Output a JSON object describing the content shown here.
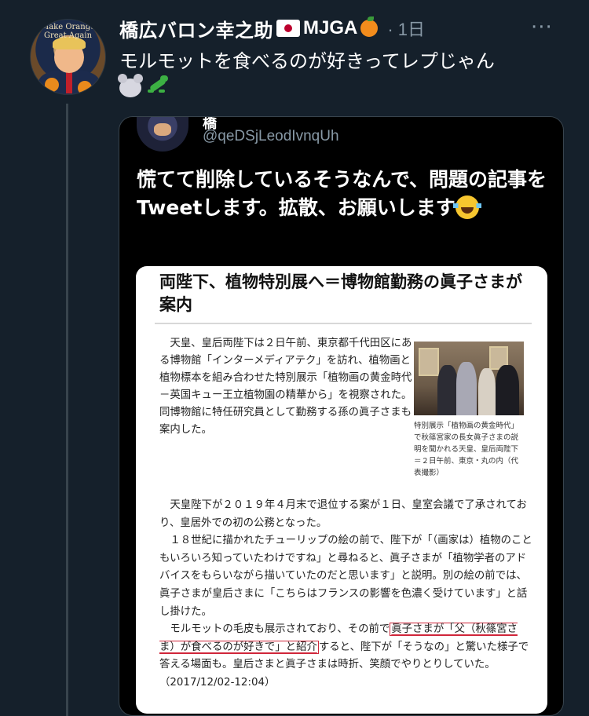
{
  "tweet": {
    "display_name": "橋広バロン幸之助",
    "name_suffix": "MJGA",
    "time": "· 1日",
    "more": "···",
    "text": "モルモットを食べるのが好きってレプじゃん",
    "avatar_caption": "Make Orange Great Again"
  },
  "quoted": {
    "name": "橋",
    "handle": "@qeDSjLeodIvnqUh",
    "text": "慌てて削除しているそうなんで、問題の記事をTweetします。拡散、お願いします"
  },
  "article": {
    "title": "両陛下、植物特別展へ＝博物館勤務の眞子さまが案内",
    "paragraph1": "　天皇、皇后両陛下は２日午前、東京都千代田区にある博物館「インターメディアテク」を訪れ、植物画と植物標本を組み合わせた特別展示「植物画の黄金時代－英国キュー王立植物園の精華から」を視察された。同博物館に特任研究員として勤務する孫の眞子さまも案内した。",
    "caption": "特別展示「植物画の黄金時代」で秋篠宮家の長女眞子さまの説明を聞かれる天皇、皇后両陛下＝２日午前、東京・丸の内（代表撮影）",
    "p2_a": "　天皇陛下が２０１９年４月末で退位する案が１日、皇室会議で了承されており、皇居外での初の公務となった。",
    "p2_b": "　１８世紀に描かれたチューリップの絵の前で、陛下が「（画家は）植物のこともいろいろ知っていたわけですね」と尋ねると、眞子さまが「植物学者のアドバイスをもらいながら描いていたのだと思います」と説明。別の絵の前では、眞子さまが皇后さまに「こちらはフランスの影響を色濃く受けています」と話し掛けた。",
    "p2_c_pre": "　モルモットの毛皮も展示されており、その前で",
    "p2_c_hl": "眞子さまが「父（秋篠宮さま）が食べるのが好きで」と紹介",
    "p2_c_post": "すると、陛下が「そうなの」と驚いた様子で答える場面も。皇后さまと眞子さまは時折、笑顔でやりとりしていた。（2017/12/02-12:04）"
  },
  "colors": {
    "background": "#15202b",
    "quote_bg": "#000000",
    "muted": "#8899a6",
    "underline": "#d0263a"
  },
  "icons": [
    "japan-flag-icon",
    "orange-emoji-icon",
    "mouse-emoji-icon",
    "lizard-emoji-icon",
    "laughing-tears-emoji-icon",
    "more-icon"
  ]
}
